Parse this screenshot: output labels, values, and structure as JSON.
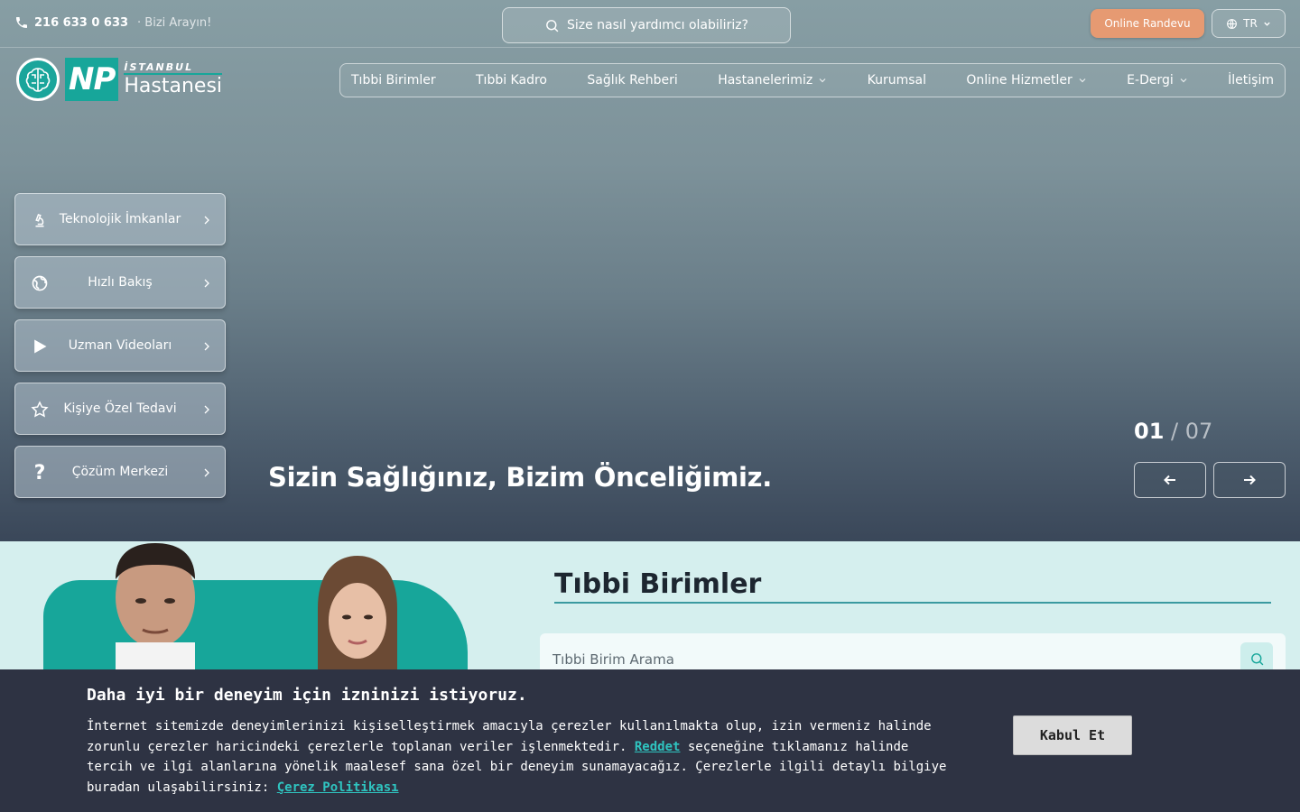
{
  "topbar": {
    "phone_number": "216 633 0 633",
    "phone_cta": "· Bizi Arayın!",
    "search_placeholder": "Size nasıl yardımcı olabiliriz?",
    "appointment_label": "Online Randevu",
    "language_label": "TR"
  },
  "logo": {
    "np": "NP",
    "city": "İSTANBUL",
    "name": "Hastanesi"
  },
  "nav": {
    "items": [
      {
        "label": "Tıbbi Birimler",
        "dropdown": false
      },
      {
        "label": "Tıbbi Kadro",
        "dropdown": false
      },
      {
        "label": "Sağlık Rehberi",
        "dropdown": false
      },
      {
        "label": "Hastanelerimiz",
        "dropdown": true
      },
      {
        "label": "Kurumsal",
        "dropdown": false
      },
      {
        "label": "Online Hizmetler",
        "dropdown": true
      },
      {
        "label": "E-Dergi",
        "dropdown": true
      },
      {
        "label": "İletişim",
        "dropdown": false
      }
    ]
  },
  "quick_menu": {
    "items": [
      {
        "label": "Teknolojik İmkanlar",
        "icon": "microscope-icon"
      },
      {
        "label": "Hızlı Bakış",
        "icon": "globe-icon"
      },
      {
        "label": "Uzman Videoları",
        "icon": "play-icon"
      },
      {
        "label": "Kişiye Özel Tedavi",
        "icon": "star-icon"
      },
      {
        "label": "Çözüm Merkezi",
        "icon": "question-icon"
      }
    ]
  },
  "hero": {
    "title": "Sizin Sağlığınız, Bizim Önceliğimiz.",
    "slide_current": "01",
    "slide_separator": "/",
    "slide_total": "07"
  },
  "units": {
    "title": "Tıbbi Birimler",
    "search_placeholder": "Tıbbi Birim Arama"
  },
  "cookie": {
    "title": "Daha iyi bir deneyim için izninizi istiyoruz.",
    "text_1": "İnternet sitemizde deneyimlerinizi kişiselleştirmek amacıyla çerezler kullanılmakta olup, izin vermeniz halinde zorunlu çerezler haricindeki çerezlerle toplanan veriler işlenmektedir. ",
    "reject_link": "Reddet",
    "text_2": " seçeneğine tıklamanız halinde tercih ve ilgi alanlarına yönelik maalesef sana özel bir deneyim sunamayacağız. Çerezlerle ilgili detaylı bilgiye buradan ulaşabilirsiniz: ",
    "policy_link": "Çerez Politikası",
    "accept_label": "Kabul Et"
  },
  "colors": {
    "accent": "#17a69a",
    "appointment": "#e69a72",
    "cookie_bg": "#2e3343",
    "link": "#2fc4c0"
  }
}
